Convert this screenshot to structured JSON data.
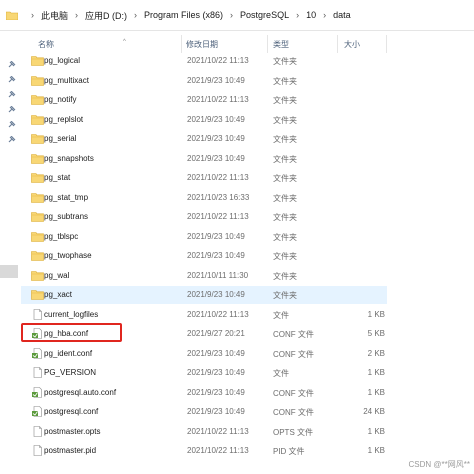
{
  "breadcrumb": {
    "segments": [
      "此电脑",
      "应用D (D:)",
      "Program Files (x86)",
      "PostgreSQL",
      "10",
      "data"
    ]
  },
  "columns": {
    "name": "名称",
    "date": "修改日期",
    "type": "类型",
    "size": "大小"
  },
  "files": [
    {
      "name": "pg_logical",
      "date": "2021/10/22 11:13",
      "type": "文件夹",
      "size": "",
      "kind": "folder"
    },
    {
      "name": "pg_multixact",
      "date": "2021/9/23 10:49",
      "type": "文件夹",
      "size": "",
      "kind": "folder"
    },
    {
      "name": "pg_notify",
      "date": "2021/10/22 11:13",
      "type": "文件夹",
      "size": "",
      "kind": "folder"
    },
    {
      "name": "pg_replslot",
      "date": "2021/9/23 10:49",
      "type": "文件夹",
      "size": "",
      "kind": "folder"
    },
    {
      "name": "pg_serial",
      "date": "2021/9/23 10:49",
      "type": "文件夹",
      "size": "",
      "kind": "folder"
    },
    {
      "name": "pg_snapshots",
      "date": "2021/9/23 10:49",
      "type": "文件夹",
      "size": "",
      "kind": "folder"
    },
    {
      "name": "pg_stat",
      "date": "2021/10/22 11:13",
      "type": "文件夹",
      "size": "",
      "kind": "folder"
    },
    {
      "name": "pg_stat_tmp",
      "date": "2021/10/23 16:33",
      "type": "文件夹",
      "size": "",
      "kind": "folder"
    },
    {
      "name": "pg_subtrans",
      "date": "2021/10/22 11:13",
      "type": "文件夹",
      "size": "",
      "kind": "folder"
    },
    {
      "name": "pg_tblspc",
      "date": "2021/9/23 10:49",
      "type": "文件夹",
      "size": "",
      "kind": "folder"
    },
    {
      "name": "pg_twophase",
      "date": "2021/9/23 10:49",
      "type": "文件夹",
      "size": "",
      "kind": "folder"
    },
    {
      "name": "pg_wal",
      "date": "2021/10/11 11:30",
      "type": "文件夹",
      "size": "",
      "kind": "folder"
    },
    {
      "name": "pg_xact",
      "date": "2021/9/23 10:49",
      "type": "文件夹",
      "size": "",
      "kind": "folder",
      "selected": true
    },
    {
      "name": "current_logfiles",
      "date": "2021/10/22 11:13",
      "type": "文件",
      "size": "1 KB",
      "kind": "file"
    },
    {
      "name": "pg_hba.conf",
      "date": "2021/9/27 20:21",
      "type": "CONF 文件",
      "size": "5 KB",
      "kind": "conf"
    },
    {
      "name": "pg_ident.conf",
      "date": "2021/9/23 10:49",
      "type": "CONF 文件",
      "size": "2 KB",
      "kind": "conf"
    },
    {
      "name": "PG_VERSION",
      "date": "2021/9/23 10:49",
      "type": "文件",
      "size": "1 KB",
      "kind": "file"
    },
    {
      "name": "postgresql.auto.conf",
      "date": "2021/9/23 10:49",
      "type": "CONF 文件",
      "size": "1 KB",
      "kind": "conf"
    },
    {
      "name": "postgresql.conf",
      "date": "2021/9/23 10:49",
      "type": "CONF 文件",
      "size": "24 KB",
      "kind": "conf"
    },
    {
      "name": "postmaster.opts",
      "date": "2021/10/22 11:13",
      "type": "OPTS 文件",
      "size": "1 KB",
      "kind": "file"
    },
    {
      "name": "postmaster.pid",
      "date": "2021/10/22 11:13",
      "type": "PID 文件",
      "size": "1 KB",
      "kind": "file"
    }
  ],
  "watermark": "CSDN @**网风**",
  "colors": {
    "folder": "#f8d775",
    "selected_row": "#e5f3ff",
    "highlight": "#e0261f"
  }
}
